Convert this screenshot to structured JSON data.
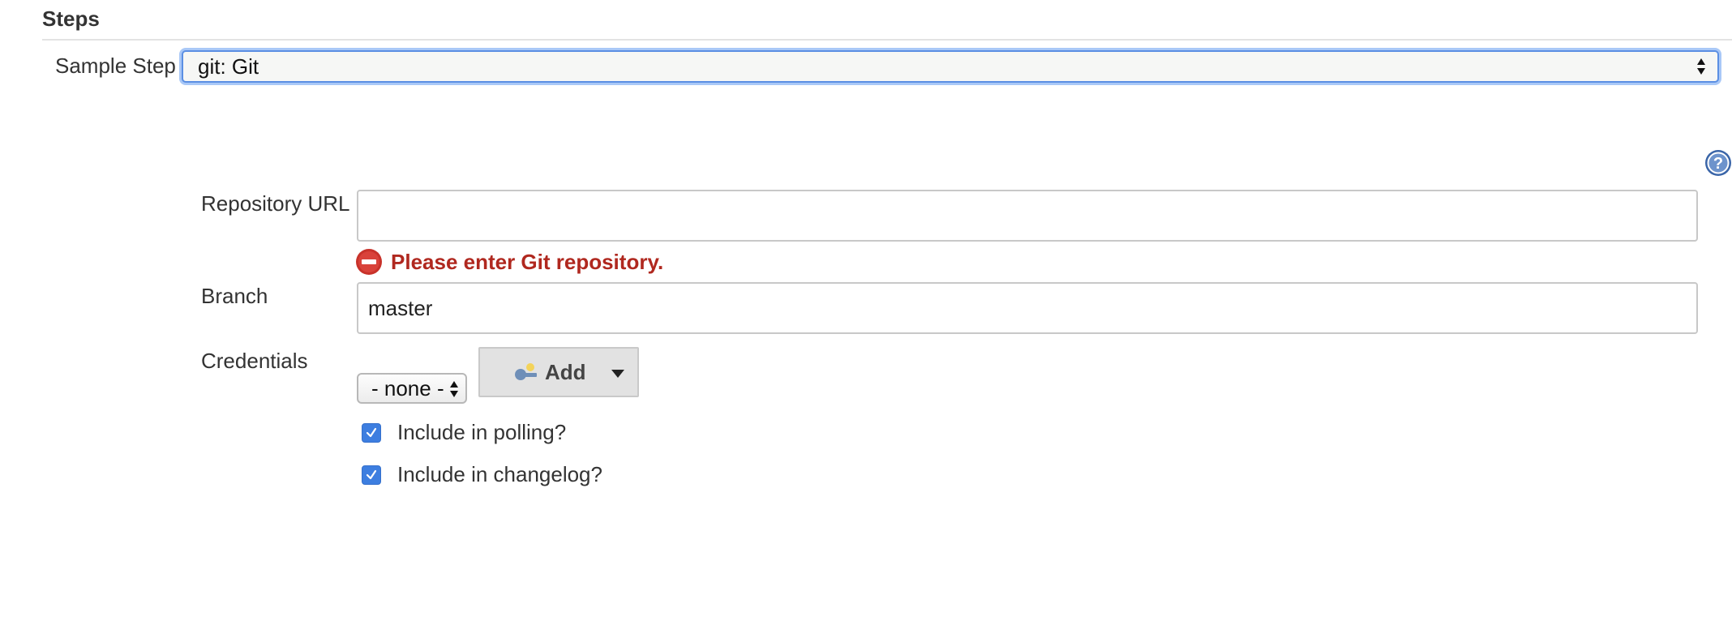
{
  "section": {
    "title": "Steps"
  },
  "sample_step": {
    "label": "Sample Step",
    "selected": "git: Git"
  },
  "form": {
    "repository_url": {
      "label": "Repository URL",
      "value": ""
    },
    "error": {
      "message": "Please enter Git repository.",
      "color": "#b0281f"
    },
    "branch": {
      "label": "Branch",
      "value": "master"
    },
    "credentials": {
      "label": "Credentials",
      "selected": "- none -",
      "add_button": {
        "label": "Add",
        "icon": "key-icon"
      }
    },
    "checkboxes": [
      {
        "label": "Include in polling?",
        "checked": true
      },
      {
        "label": "Include in changelog?",
        "checked": true
      }
    ]
  },
  "icons": {
    "help": "help-icon",
    "error": "error-icon",
    "dropdown": "chevron-down-icon"
  },
  "colors": {
    "accent": "#3d7ee0",
    "focus_ring": "#a9c8f7",
    "error": "#b0281f"
  }
}
